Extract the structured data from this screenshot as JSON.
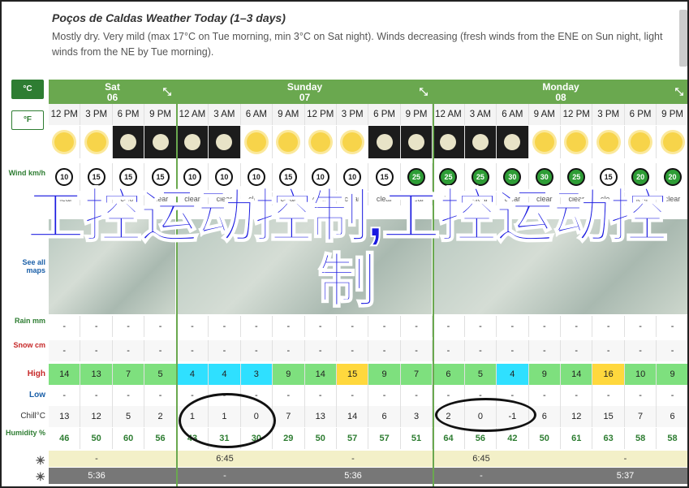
{
  "header": {
    "title": "Poços de Caldas Weather Today (1–3 days)",
    "summary": "Mostly dry. Very mild (max 17°C on Tue morning, min 3°C on Sat night). Winds decreasing (fresh winds from the ENE on Sun night, light winds from the NE by Tue morning)."
  },
  "units": {
    "c": "°C",
    "f": "°F"
  },
  "labels": {
    "wind": "Wind km/h",
    "maps": "See all maps",
    "rain": "Rain mm",
    "snow": "Snow cm",
    "high": "High",
    "low": "Low",
    "chill": "Chill°C",
    "humidity": "Humidity %"
  },
  "days": [
    {
      "name": "Sat",
      "date": "06"
    },
    {
      "name": "Sunday",
      "date": "07"
    },
    {
      "name": "Monday",
      "date": "08"
    }
  ],
  "times": [
    "12 PM",
    "3 PM",
    "6 PM",
    "9 PM",
    "12 AM",
    "3 AM",
    "6 AM",
    "9 AM",
    "12 PM",
    "3 PM",
    "6 PM",
    "9 PM",
    "12 AM",
    "3 AM",
    "6 AM",
    "9 AM",
    "12 PM",
    "3 PM",
    "6 PM",
    "9 PM"
  ],
  "wind": [
    "10",
    "15",
    "15",
    "15",
    "10",
    "10",
    "10",
    "15",
    "10",
    "10",
    "15",
    "25",
    "25",
    "25",
    "30",
    "30",
    "25",
    "15",
    "20",
    "20"
  ],
  "cond": [
    "clear",
    "clear",
    "clear",
    "clear",
    "clear",
    "clear",
    "clear",
    "clear",
    "clear",
    "clear",
    "clear",
    "clear",
    "clear",
    "clear",
    "clear",
    "clear",
    "clear",
    "clear",
    "clear",
    "clear"
  ],
  "rain": [
    "-",
    "-",
    "-",
    "-",
    "-",
    "-",
    "-",
    "-",
    "-",
    "-",
    "-",
    "-",
    "-",
    "-",
    "-",
    "-",
    "-",
    "-",
    "-",
    "-"
  ],
  "snow": [
    "-",
    "-",
    "-",
    "-",
    "-",
    "-",
    "-",
    "-",
    "-",
    "-",
    "-",
    "-",
    "-",
    "-",
    "-",
    "-",
    "-",
    "-",
    "-",
    "-"
  ],
  "high": [
    "14",
    "13",
    "7",
    "5",
    "4",
    "4",
    "3",
    "9",
    "14",
    "15",
    "9",
    "7",
    "6",
    "5",
    "4",
    "9",
    "14",
    "16",
    "10",
    "9"
  ],
  "low": [
    "-",
    "-",
    "-",
    "-",
    "-",
    "-",
    "-",
    "-",
    "-",
    "-",
    "-",
    "-",
    "-",
    "-",
    "-",
    "-",
    "-",
    "-",
    "-",
    "-"
  ],
  "chill": [
    "13",
    "12",
    "5",
    "2",
    "1",
    "1",
    "0",
    "7",
    "13",
    "14",
    "6",
    "3",
    "2",
    "0",
    "-1",
    "6",
    "12",
    "15",
    "7",
    "6"
  ],
  "humidity": [
    "46",
    "50",
    "60",
    "56",
    "43",
    "31",
    "30",
    "29",
    "50",
    "57",
    "57",
    "51",
    "64",
    "56",
    "42",
    "50",
    "61",
    "63",
    "58",
    "58"
  ],
  "sunrise": [
    "-",
    "6:45",
    "-",
    "6:45",
    "-"
  ],
  "sunset": [
    "5:36",
    "-",
    "5:36",
    "-",
    "5:37"
  ],
  "overlay": "工控运动控制,工控运动控制",
  "colors": {
    "accent": "#6aa84f",
    "overlay_text": "#1a1ae0",
    "high_warm": "#7ee07e",
    "high_mid": "#ffd83d",
    "high_cold": "#2fe0ff"
  }
}
